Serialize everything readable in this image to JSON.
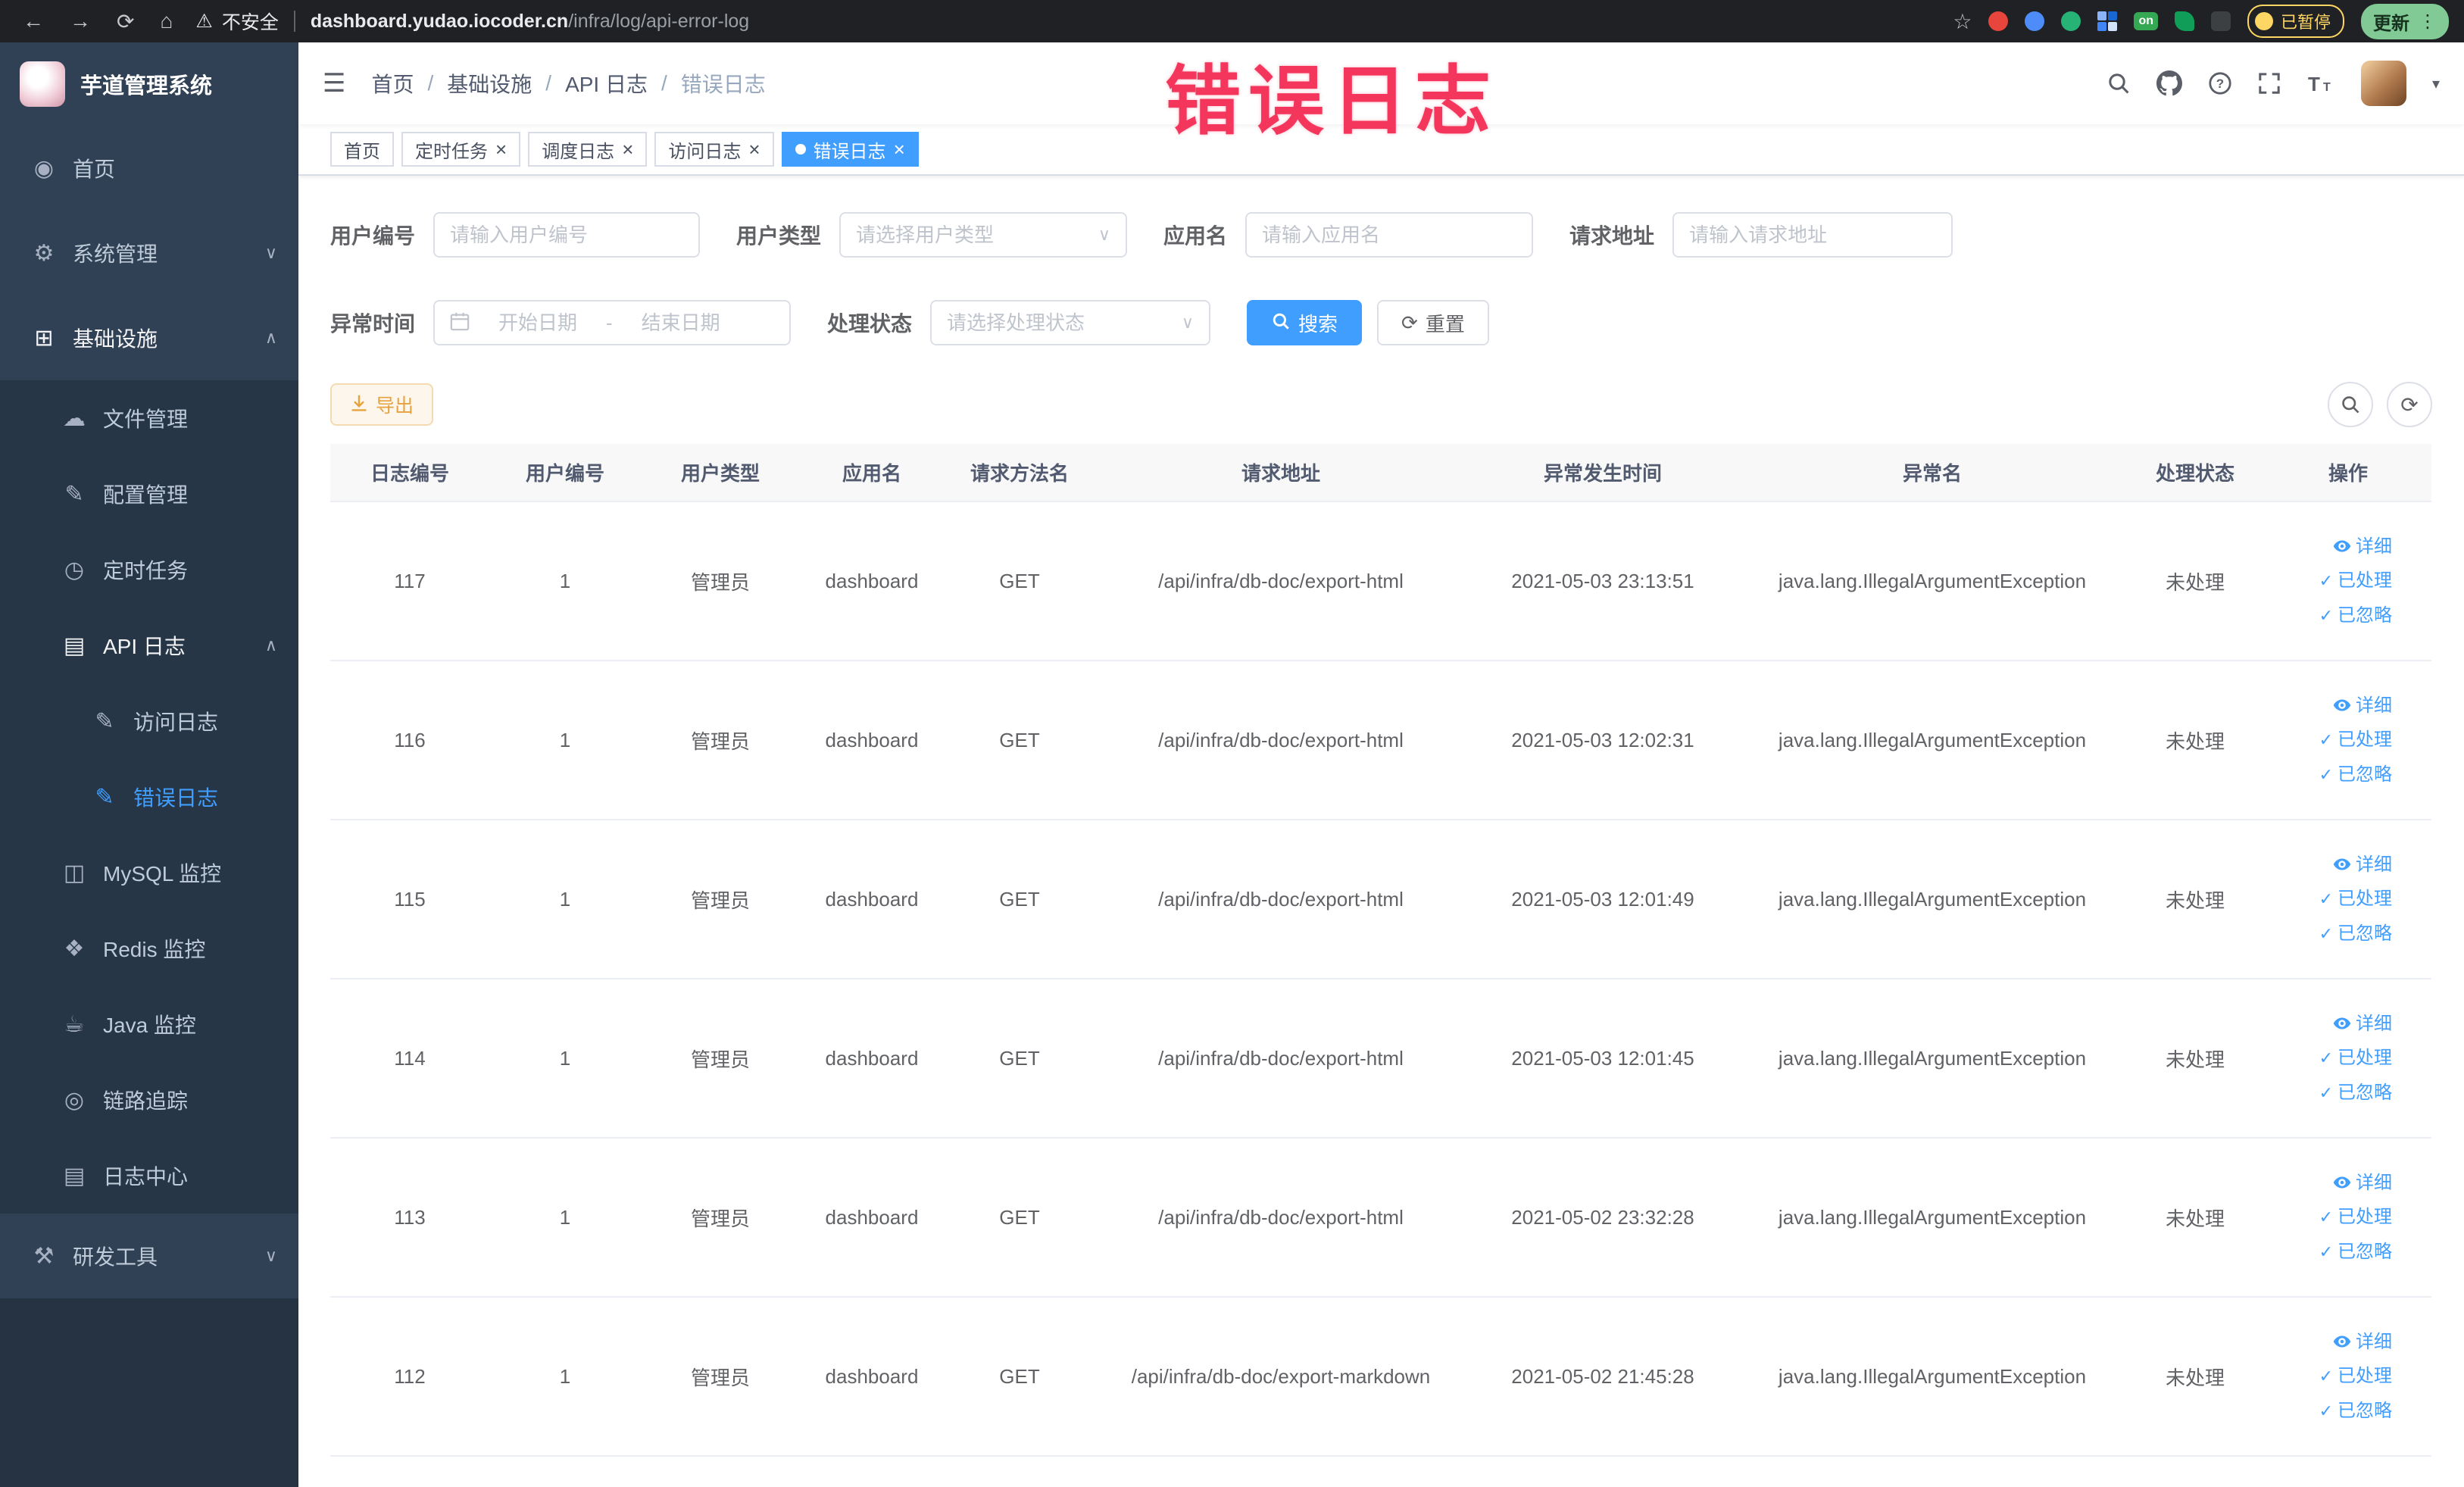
{
  "browser": {
    "security_label": "不安全",
    "url_domain": "dashboard.yudao.iocoder.cn",
    "url_path": "/infra/log/api-error-log",
    "ext_on_label": "on",
    "paused_label": "已暂停",
    "update_label": "更新"
  },
  "icons": {
    "back": "←",
    "forward": "→",
    "reload": "⟳",
    "home": "⌂",
    "warning": "⚠",
    "star": "☆",
    "kebab": "⋮",
    "hamburger": "☰",
    "caret": "▾",
    "chevron_down": "∨",
    "chevron_up": "∧",
    "close": "×",
    "menu_home": "◉",
    "menu_system": "⚙",
    "menu_infra": "⊞",
    "menu_file": "☁",
    "menu_config": "✎",
    "menu_schedule": "◷",
    "menu_apilog": "▤",
    "menu_doc": "✎",
    "menu_mysql": "◫",
    "menu_redis": "❖",
    "menu_java": "☕",
    "menu_trace": "◎",
    "menu_logcenter": "▤",
    "menu_tools": "⚒",
    "refresh": "⟳",
    "check": "✓",
    "separator": "/"
  },
  "sidebar": {
    "title": "芋道管理系统",
    "items": [
      {
        "label": "首页"
      },
      {
        "label": "系统管理"
      },
      {
        "label": "基础设施"
      },
      {
        "label": "文件管理"
      },
      {
        "label": "配置管理"
      },
      {
        "label": "定时任务"
      },
      {
        "label": "API 日志"
      },
      {
        "label": "访问日志"
      },
      {
        "label": "错误日志"
      },
      {
        "label": "MySQL 监控"
      },
      {
        "label": "Redis 监控"
      },
      {
        "label": "Java 监控"
      },
      {
        "label": "链路追踪"
      },
      {
        "label": "日志中心"
      },
      {
        "label": "研发工具"
      }
    ]
  },
  "breadcrumb": [
    "首页",
    "基础设施",
    "API 日志",
    "错误日志"
  ],
  "watermark": "错误日志",
  "tabs": [
    {
      "label": "首页"
    },
    {
      "label": "定时任务"
    },
    {
      "label": "调度日志"
    },
    {
      "label": "访问日志"
    },
    {
      "label": "错误日志"
    }
  ],
  "filters": {
    "user_id": {
      "label": "用户编号",
      "placeholder": "请输入用户编号"
    },
    "user_type": {
      "label": "用户类型",
      "placeholder": "请选择用户类型"
    },
    "app_name": {
      "label": "应用名",
      "placeholder": "请输入应用名"
    },
    "request_url": {
      "label": "请求地址",
      "placeholder": "请输入请求地址"
    },
    "exception_time": {
      "label": "异常时间",
      "start_placeholder": "开始日期",
      "separator": "-",
      "end_placeholder": "结束日期"
    },
    "process_status": {
      "label": "处理状态",
      "placeholder": "请选择处理状态"
    },
    "search_label": "搜索",
    "reset_label": "重置"
  },
  "toolbar": {
    "export_label": "导出"
  },
  "table": {
    "columns": [
      "日志编号",
      "用户编号",
      "用户类型",
      "应用名",
      "请求方法名",
      "请求地址",
      "异常发生时间",
      "异常名",
      "处理状态",
      "操作"
    ],
    "actions": {
      "detail": "详细",
      "processed": "已处理",
      "ignored": "已忽略"
    },
    "rows": [
      {
        "id": "117",
        "user_id": "1",
        "user_type": "管理员",
        "app": "dashboard",
        "method": "GET",
        "url": "/api/infra/db-doc/export-html",
        "time": "2021-05-03 23:13:51",
        "exception": "java.lang.IllegalArgumentException",
        "status": "未处理"
      },
      {
        "id": "116",
        "user_id": "1",
        "user_type": "管理员",
        "app": "dashboard",
        "method": "GET",
        "url": "/api/infra/db-doc/export-html",
        "time": "2021-05-03 12:02:31",
        "exception": "java.lang.IllegalArgumentException",
        "status": "未处理"
      },
      {
        "id": "115",
        "user_id": "1",
        "user_type": "管理员",
        "app": "dashboard",
        "method": "GET",
        "url": "/api/infra/db-doc/export-html",
        "time": "2021-05-03 12:01:49",
        "exception": "java.lang.IllegalArgumentException",
        "status": "未处理"
      },
      {
        "id": "114",
        "user_id": "1",
        "user_type": "管理员",
        "app": "dashboard",
        "method": "GET",
        "url": "/api/infra/db-doc/export-html",
        "time": "2021-05-03 12:01:45",
        "exception": "java.lang.IllegalArgumentException",
        "status": "未处理"
      },
      {
        "id": "113",
        "user_id": "1",
        "user_type": "管理员",
        "app": "dashboard",
        "method": "GET",
        "url": "/api/infra/db-doc/export-html",
        "time": "2021-05-02 23:32:28",
        "exception": "java.lang.IllegalArgumentException",
        "status": "未处理"
      },
      {
        "id": "112",
        "user_id": "1",
        "user_type": "管理员",
        "app": "dashboard",
        "method": "GET",
        "url": "/api/infra/db-doc/export-markdown",
        "time": "2021-05-02 21:45:28",
        "exception": "java.lang.IllegalArgumentException",
        "status": "未处理"
      }
    ]
  },
  "colors": {
    "accent": "#409eff",
    "watermark": "#f5365c",
    "sidebar_bg": "#304156",
    "warning_button": "#e6a23c",
    "paused_badge": "#fdd663",
    "update_badge": "#81c995"
  }
}
